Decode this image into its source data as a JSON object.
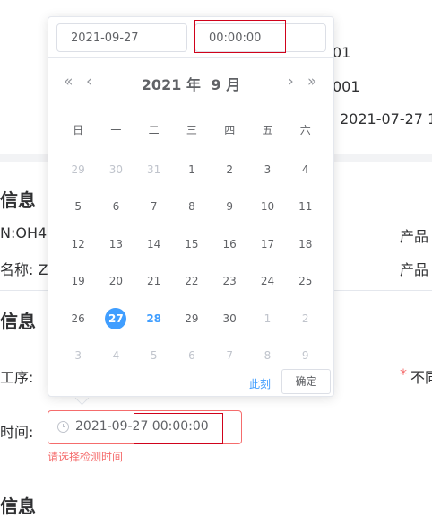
{
  "background": {
    "top_right_line1": "01",
    "top_right_line2": "001",
    "top_right_line3": "2021-07-27 1",
    "section1_title": "信息",
    "field_code": "N:OH4",
    "field_product_right1": "产品",
    "field_name": "名称: Z",
    "field_product_right2": "产品",
    "section2_title": "信息",
    "process_label": "工序:",
    "required_mark": "*",
    "not_label": "不同",
    "time_label": "时间:",
    "date_value": "2021-09-27 00:00:00",
    "error_text": "请选择检测时间",
    "section3_title": "信息"
  },
  "picker": {
    "date_input": "2021-09-27",
    "time_input": "00:00:00",
    "prev_year": "«",
    "prev_month": "‹",
    "next_month": "›",
    "next_year": "»",
    "year": "2021 年",
    "month": "9 月",
    "weekdays": [
      "日",
      "一",
      "二",
      "三",
      "四",
      "五",
      "六"
    ],
    "weeks": [
      [
        "29",
        "30",
        "31",
        "1",
        "2",
        "3",
        "4"
      ],
      [
        "5",
        "6",
        "7",
        "8",
        "9",
        "10",
        "11"
      ],
      [
        "12",
        "13",
        "14",
        "15",
        "16",
        "17",
        "18"
      ],
      [
        "19",
        "20",
        "21",
        "22",
        "23",
        "24",
        "25"
      ],
      [
        "26",
        "27",
        "28",
        "29",
        "30",
        "1",
        "2"
      ],
      [
        "3",
        "4",
        "5",
        "6",
        "7",
        "8",
        "9"
      ]
    ],
    "selected_day": "27",
    "today_day": "28",
    "now_label": "此刻",
    "confirm_label": "确定"
  },
  "colors": {
    "accent": "#409eff",
    "error": "#f56c6c",
    "highlight_box": "#d0021b"
  }
}
